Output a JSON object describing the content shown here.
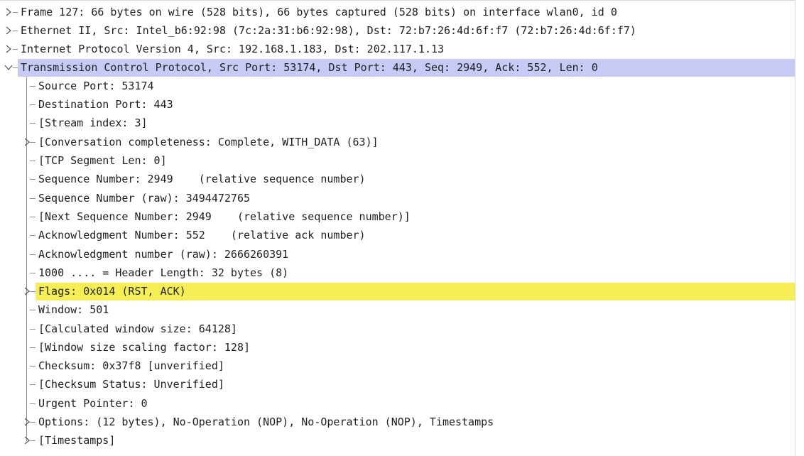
{
  "packet_details": {
    "nodes": [
      {
        "label": "Frame 127: 66 bytes on wire (528 bits), 66 bytes captured (528 bits) on interface wlan0, id 0",
        "state": "collapsed"
      },
      {
        "label": "Ethernet II, Src: Intel_b6:92:98 (7c:2a:31:b6:92:98), Dst: 72:b7:26:4d:6f:f7 (72:b7:26:4d:6f:f7)",
        "state": "collapsed"
      },
      {
        "label": "Internet Protocol Version 4, Src: 192.168.1.183, Dst: 202.117.1.13",
        "state": "collapsed"
      },
      {
        "label": "Transmission Control Protocol, Src Port: 53174, Dst Port: 443, Seq: 2949, Ack: 552, Len: 0",
        "state": "expanded",
        "selected": true
      }
    ],
    "tcp_fields": [
      {
        "label": "Source Port: 53174"
      },
      {
        "label": "Destination Port: 443"
      },
      {
        "label": "[Stream index: 3]"
      },
      {
        "label": "[Conversation completeness: Complete, WITH_DATA (63)]",
        "expandable": true
      },
      {
        "label": "[TCP Segment Len: 0]"
      },
      {
        "label": "Sequence Number: 2949    (relative sequence number)"
      },
      {
        "label": "Sequence Number (raw): 3494472765"
      },
      {
        "label": "[Next Sequence Number: 2949    (relative sequence number)]"
      },
      {
        "label": "Acknowledgment Number: 552    (relative ack number)"
      },
      {
        "label": "Acknowledgment number (raw): 2666260391"
      },
      {
        "label": "1000 .... = Header Length: 32 bytes (8)"
      },
      {
        "label": "Flags: 0x014 (RST, ACK)",
        "expandable": true,
        "highlighted": true
      },
      {
        "label": "Window: 501"
      },
      {
        "label": "[Calculated window size: 64128]"
      },
      {
        "label": "[Window size scaling factor: 128]"
      },
      {
        "label": "Checksum: 0x37f8 [unverified]"
      },
      {
        "label": "[Checksum Status: Unverified]"
      },
      {
        "label": "Urgent Pointer: 0"
      },
      {
        "label": "Options: (12 bytes), No-Operation (NOP), No-Operation (NOP), Timestamps",
        "expandable": true
      },
      {
        "label": "[Timestamps]",
        "expandable": true
      }
    ]
  },
  "colors": {
    "selected_row": "#c7caf4",
    "highlight_row": "#f5ef55",
    "tree_line": "#8e8e8e",
    "text": "#1f1f1f"
  },
  "icons": {
    "collapsed": "chevron-right-icon",
    "expanded": "chevron-down-icon"
  }
}
